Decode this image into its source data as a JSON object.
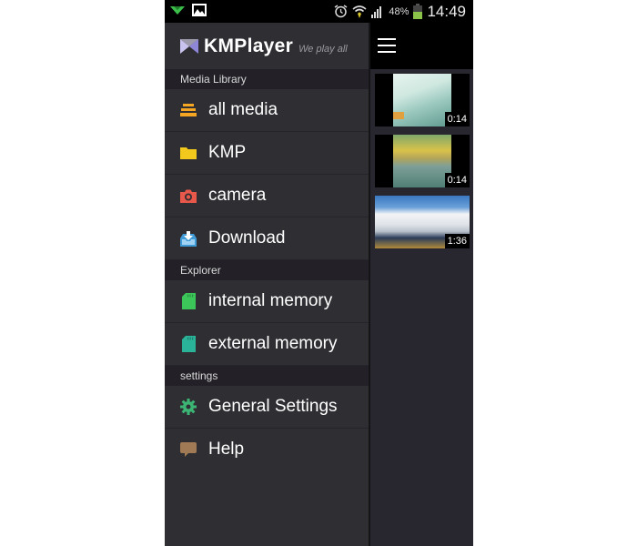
{
  "status_bar": {
    "battery_percent": "48%",
    "time": "14:49",
    "icons": [
      "notification-arrow-icon",
      "image-icon",
      "alarm-icon",
      "wifi-icon",
      "signal-icon",
      "battery-icon"
    ]
  },
  "drawer": {
    "logo": {
      "name": "KMPlayer",
      "tagline": "We play all"
    },
    "sections": [
      {
        "title": "Media Library",
        "items": [
          {
            "label": "all media",
            "icon": "stack-icon",
            "color": "#f5a623"
          },
          {
            "label": "KMP",
            "icon": "folder-icon",
            "color": "#f2c81c"
          },
          {
            "label": "camera",
            "icon": "camera-icon",
            "color": "#e8584a"
          },
          {
            "label": "Download",
            "icon": "download-icon",
            "color": "#3f9ad6"
          }
        ]
      },
      {
        "title": "Explorer",
        "items": [
          {
            "label": "internal memory",
            "icon": "sd-card-icon",
            "color": "#3cc65a"
          },
          {
            "label": "external memory",
            "icon": "sd-card-icon",
            "color": "#2bb39a"
          }
        ]
      },
      {
        "title": "settings",
        "items": [
          {
            "label": "General Settings",
            "icon": "gear-icon",
            "color": "#3cb574"
          },
          {
            "label": "Help",
            "icon": "speech-bubble-icon",
            "color": "#a07a55"
          }
        ]
      }
    ]
  },
  "content": {
    "menu_icon": "hamburger-icon",
    "videos": [
      {
        "duration": "0:14"
      },
      {
        "duration": "0:14"
      },
      {
        "duration": "1:36"
      }
    ]
  }
}
